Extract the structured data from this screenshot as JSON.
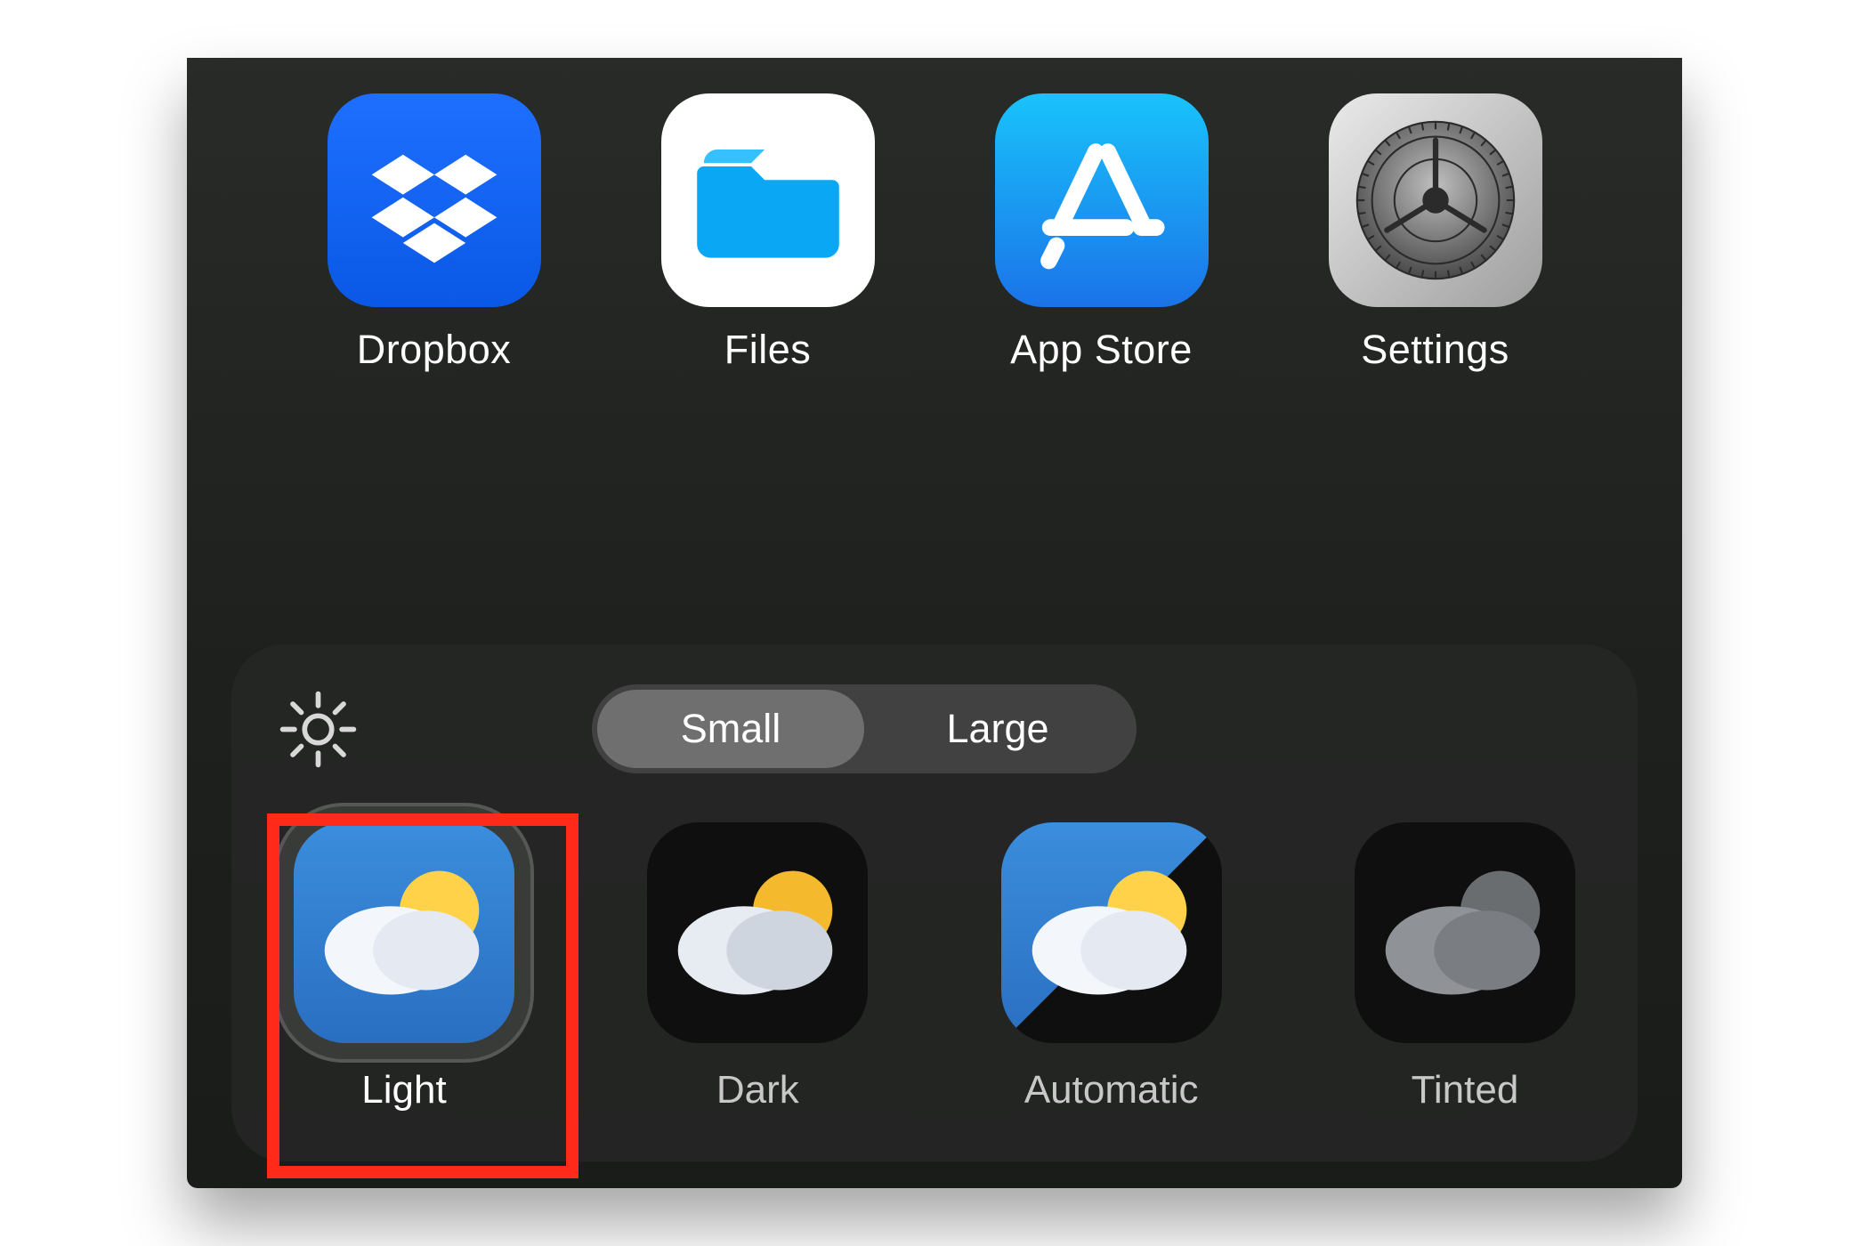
{
  "apps": [
    {
      "name": "dropbox",
      "label": "Dropbox"
    },
    {
      "name": "files",
      "label": "Files"
    },
    {
      "name": "appstore",
      "label": "App Store"
    },
    {
      "name": "settings",
      "label": "Settings"
    }
  ],
  "segmented": {
    "small": "Small",
    "large": "Large",
    "selected": "small"
  },
  "themes": [
    {
      "key": "light",
      "label": "Light",
      "selected": true
    },
    {
      "key": "dark",
      "label": "Dark",
      "selected": false
    },
    {
      "key": "automatic",
      "label": "Automatic",
      "selected": false
    },
    {
      "key": "tinted",
      "label": "Tinted",
      "selected": false
    }
  ],
  "highlight": "light"
}
